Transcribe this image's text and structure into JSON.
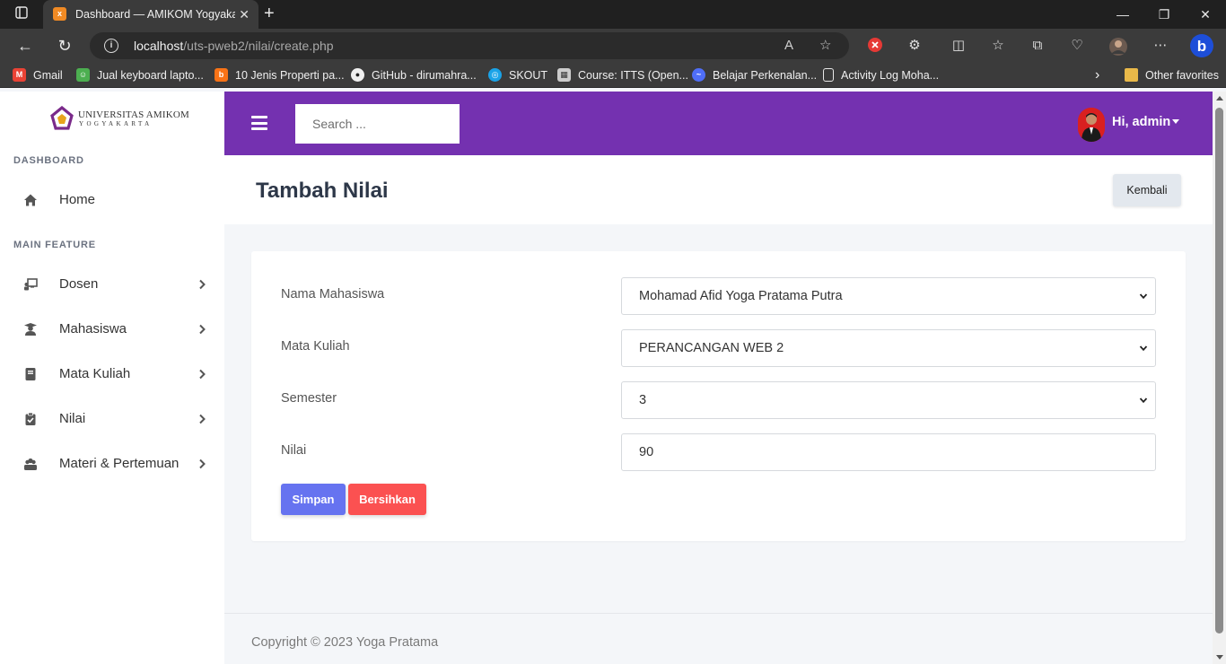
{
  "browser": {
    "tab_title": "Dashboard — AMIKOM Yogyakarta",
    "url_host": "localhost",
    "url_path": "/uts-pweb2/nilai/create.php",
    "bookmarks": [
      {
        "label": "Gmail",
        "color": "#ea4335",
        "icon": "gmail-icon"
      },
      {
        "label": "Jual keyboard lapto...",
        "color": "#4caf50",
        "icon": "tokopedia-icon"
      },
      {
        "label": "10 Jenis Properti pa...",
        "color": "#f97316",
        "icon": "blog-icon"
      },
      {
        "label": "GitHub - dirumahra...",
        "color": "#f0f0f0",
        "icon": "github-icon"
      },
      {
        "label": "SKOUT",
        "color": "#1aa3e8",
        "icon": "skout-icon"
      },
      {
        "label": "Course: ITTS (Open...",
        "color": "#cccccc",
        "icon": "moodle-icon"
      },
      {
        "label": "Belajar Perkenalan...",
        "color": "#4f6ef7",
        "icon": "belajar-icon"
      },
      {
        "label": "Activity Log Moha...",
        "color": "#e8e8e8",
        "icon": "document-icon"
      }
    ],
    "other_favorites": "Other favorites"
  },
  "sidebar": {
    "brand_line1": "UNIVERSITAS AMIKOM",
    "brand_line2": "YOGYAKARTA",
    "section_dashboard": "DASHBOARD",
    "home": "Home",
    "section_main": "MAIN FEATURE",
    "items": [
      {
        "label": "Dosen",
        "icon": "chalkboard-teacher-icon"
      },
      {
        "label": "Mahasiswa",
        "icon": "user-graduate-icon"
      },
      {
        "label": "Mata Kuliah",
        "icon": "book-icon"
      },
      {
        "label": "Nilai",
        "icon": "clipboard-check-icon"
      },
      {
        "label": "Materi & Pertemuan",
        "icon": "users-icon"
      }
    ]
  },
  "topnav": {
    "search_placeholder": "Search ...",
    "greeting": "Hi, admin",
    "accent": "#7431b0"
  },
  "page": {
    "title": "Tambah Nilai",
    "back_button": "Kembali"
  },
  "form": {
    "fields": [
      {
        "label": "Nama Mahasiswa",
        "value": "Mohamad Afid Yoga Pratama Putra",
        "type": "select"
      },
      {
        "label": "Mata Kuliah",
        "value": "PERANCANGAN WEB 2",
        "type": "select"
      },
      {
        "label": "Semester",
        "value": "3",
        "type": "select"
      },
      {
        "label": "Nilai",
        "value": "90",
        "type": "input"
      }
    ],
    "save_button": "Simpan",
    "reset_button": "Bersihkan"
  },
  "footer": {
    "copyright": "Copyright © 2023 Yoga Pratama"
  }
}
